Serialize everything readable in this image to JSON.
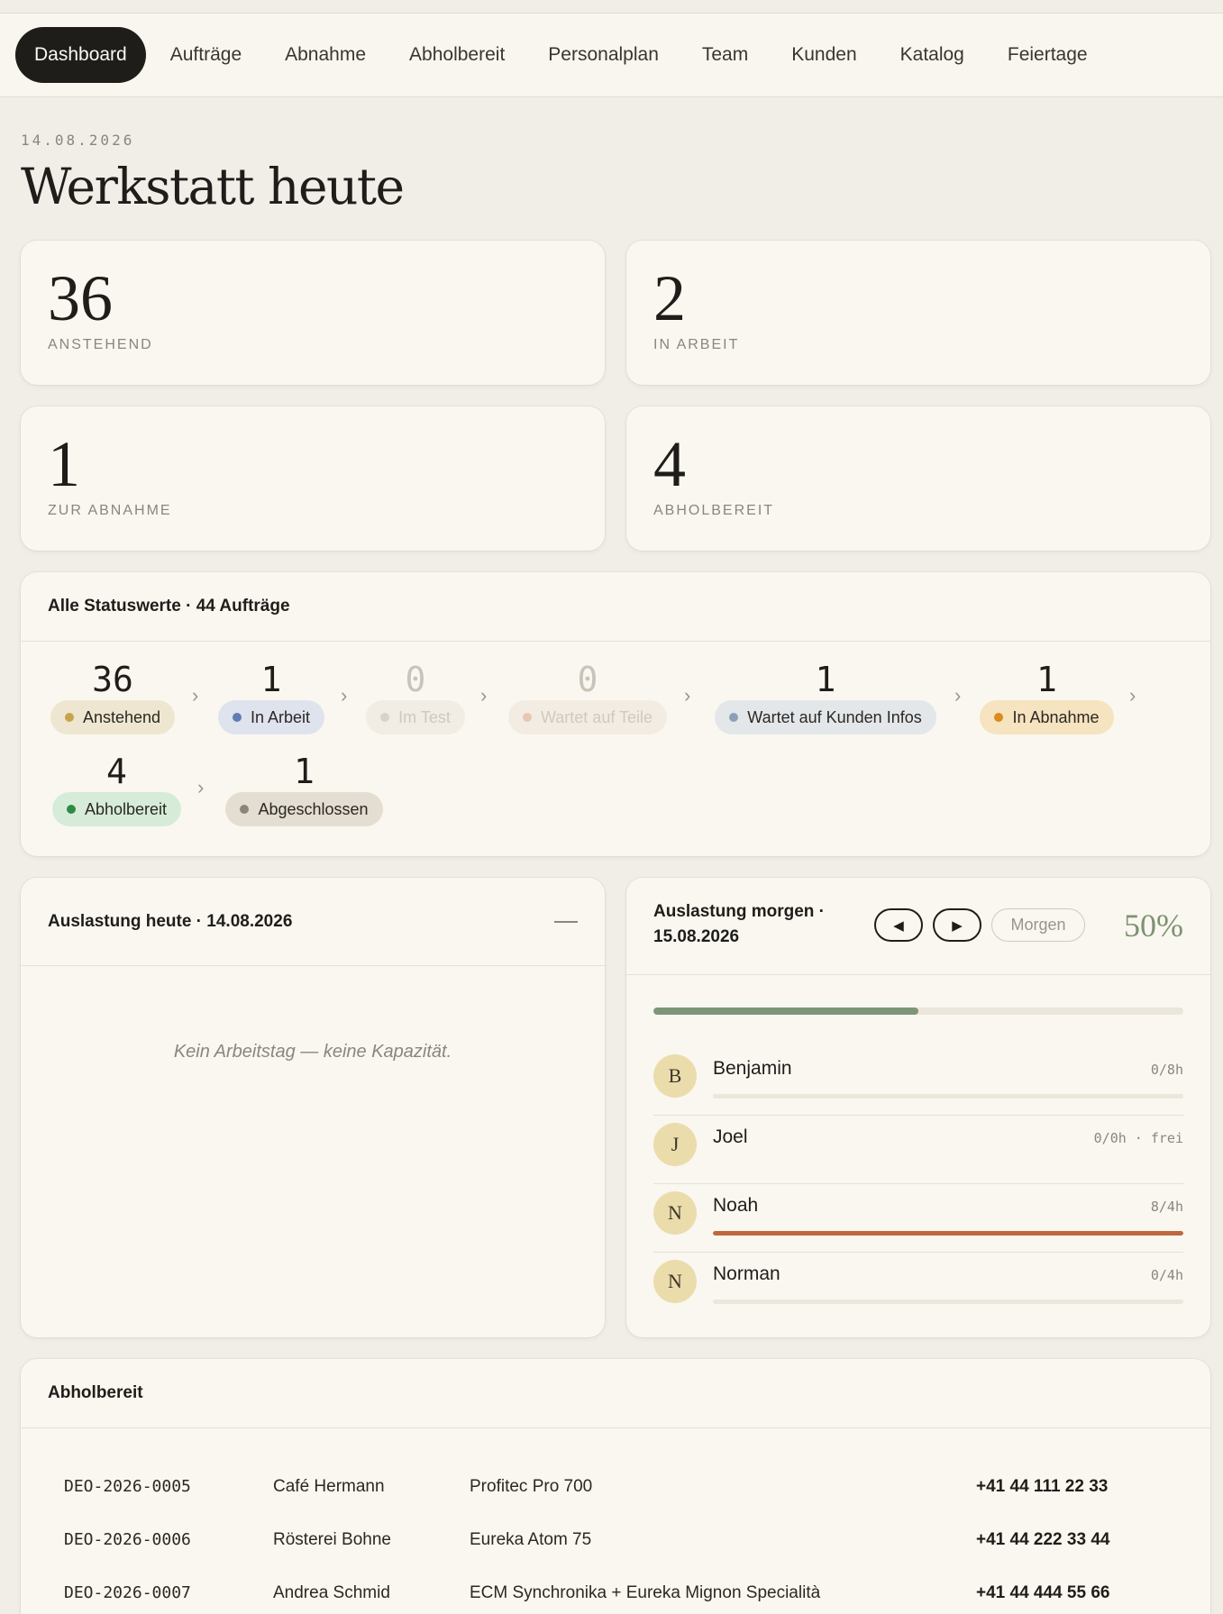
{
  "nav": {
    "items": [
      "Dashboard",
      "Aufträge",
      "Abnahme",
      "Abholbereit",
      "Personalplan",
      "Team",
      "Kunden",
      "Katalog",
      "Feiertage"
    ],
    "active": "Dashboard"
  },
  "header": {
    "date": "14.08.2026",
    "title": "Werkstatt heute"
  },
  "stats": [
    {
      "value": "36",
      "label": "ANSTEHEND"
    },
    {
      "value": "2",
      "label": "IN ARBEIT"
    },
    {
      "value": "1",
      "label": "ZUR ABNAHME"
    },
    {
      "value": "4",
      "label": "ABHOLBEREIT"
    }
  ],
  "status_overview": {
    "title": "Alle Statuswerte · 44 Aufträge",
    "items": [
      {
        "count": "36",
        "label": "Anstehend",
        "color": "#c9a24c",
        "bg": "#efe6d1",
        "dim": false
      },
      {
        "count": "1",
        "label": "In Arbeit",
        "color": "#5f7cb3",
        "bg": "#dfe3ee",
        "dim": false
      },
      {
        "count": "0",
        "label": "Im Test",
        "color": "#d8d2c8",
        "bg": "#f1ece4",
        "dim": true
      },
      {
        "count": "0",
        "label": "Wartet auf Teile",
        "color": "#e9c7b4",
        "bg": "#f3ece2",
        "dim": true
      },
      {
        "count": "1",
        "label": "Wartet auf Kunden Infos",
        "color": "#8ba0b8",
        "bg": "#e3e7ea",
        "dim": false
      },
      {
        "count": "1",
        "label": "In Abnahme",
        "color": "#d98b1c",
        "bg": "#f6e3bf",
        "dim": false
      },
      {
        "count": "4",
        "label": "Abholbereit",
        "color": "#2f8a4a",
        "bg": "#d6ecd9",
        "dim": false
      },
      {
        "count": "1",
        "label": "Abgeschlossen",
        "color": "#8a8578",
        "bg": "#e4ded2",
        "dim": false
      }
    ]
  },
  "today": {
    "title": "Auslastung heute · 14.08.2026",
    "empty_message": "Kein Arbeitstag — keine Kapazität."
  },
  "tomorrow": {
    "title": "Auslastung morgen · 15.08.2026",
    "prev_icon": "◀",
    "next_icon": "▶",
    "morgen_label": "Morgen",
    "percent_label": "50%",
    "percent": 0.5,
    "people": [
      {
        "initial": "B",
        "name": "Benjamin",
        "hours": "0/8h",
        "load": 0
      },
      {
        "initial": "J",
        "name": "Joel",
        "hours": "0/0h · frei",
        "load": 0
      },
      {
        "initial": "N",
        "name": "Noah",
        "hours": "8/4h",
        "load": 1
      },
      {
        "initial": "N",
        "name": "Norman",
        "hours": "0/4h",
        "load": 0
      }
    ]
  },
  "pickup": {
    "title": "Abholbereit",
    "rows": [
      {
        "id": "DEO-2026-0005",
        "customer": "Café Hermann",
        "item": "Profitec Pro 700",
        "phone": "+41 44 111 22 33"
      },
      {
        "id": "DEO-2026-0006",
        "customer": "Rösterei Bohne",
        "item": "Eureka Atom 75",
        "phone": "+41 44 222 33 44"
      },
      {
        "id": "DEO-2026-0007",
        "customer": "Andrea Schmid",
        "item": "ECM Synchronika + Eureka Mignon Specialità",
        "phone": "+41 44 444 55 66"
      }
    ]
  }
}
